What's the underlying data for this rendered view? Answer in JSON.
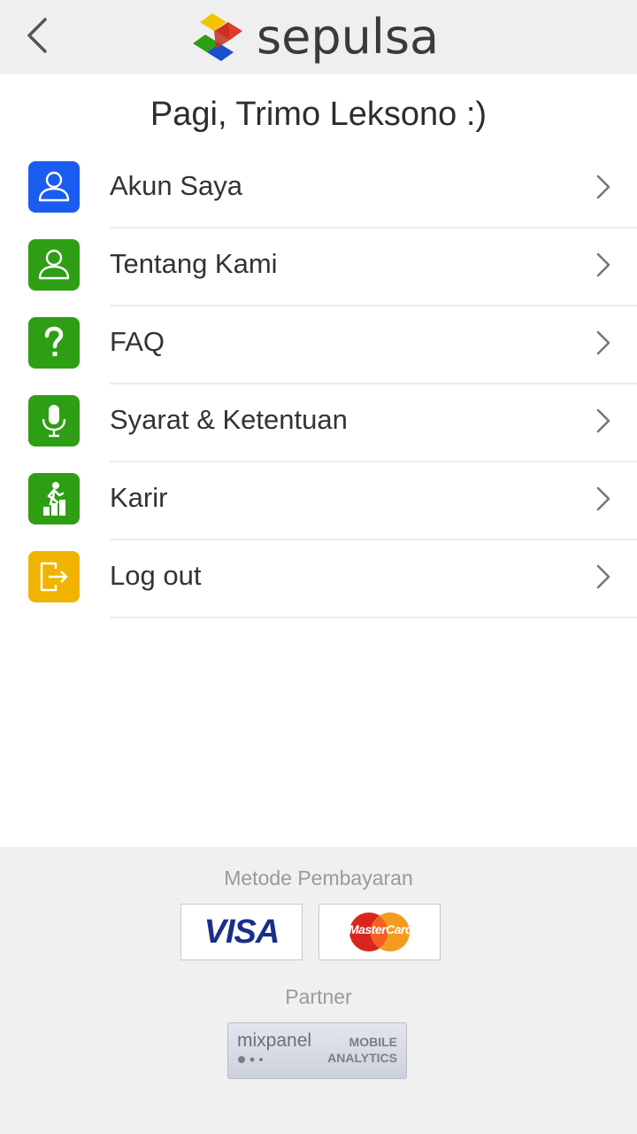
{
  "header": {
    "logo_text": "sepulsa"
  },
  "greeting": "Pagi, Trimo Leksono :)",
  "menu": [
    {
      "label": "Akun Saya",
      "icon": "user-icon",
      "color": "#1a5cf0"
    },
    {
      "label": "Tentang Kami",
      "icon": "user-icon",
      "color": "#2e9e14"
    },
    {
      "label": "FAQ",
      "icon": "question-icon",
      "color": "#2e9e14"
    },
    {
      "label": "Syarat & Ketentuan",
      "icon": "microphone-icon",
      "color": "#2e9e14"
    },
    {
      "label": "Karir",
      "icon": "career-icon",
      "color": "#2e9e14"
    },
    {
      "label": "Log out",
      "icon": "logout-icon",
      "color": "#f0b400"
    }
  ],
  "footer": {
    "payment_label": "Metode Pembayaran",
    "visa_text": "VISA",
    "mastercard_text": "MasterCard",
    "partner_label": "Partner",
    "mixpanel_brand": "mixpanel",
    "mixpanel_line1": "MOBILE",
    "mixpanel_line2": "ANALYTICS"
  }
}
